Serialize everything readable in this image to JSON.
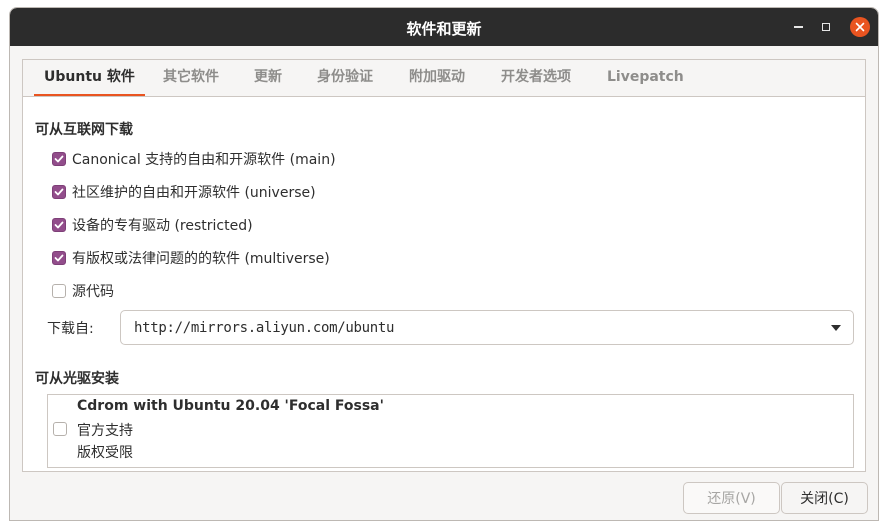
{
  "window": {
    "title": "软件和更新"
  },
  "tabs": [
    {
      "label": "Ubuntu 软件",
      "active": true
    },
    {
      "label": "其它软件"
    },
    {
      "label": "更新"
    },
    {
      "label": "身份验证"
    },
    {
      "label": "附加驱动"
    },
    {
      "label": "开发者选项"
    },
    {
      "label": "Livepatch"
    }
  ],
  "internet": {
    "title": "可从互联网下载",
    "options": [
      {
        "label": "Canonical 支持的自由和开源软件 (main)",
        "checked": true
      },
      {
        "label": "社区维护的自由和开源软件 (universe)",
        "checked": true
      },
      {
        "label": "设备的专有驱动 (restricted)",
        "checked": true
      },
      {
        "label": "有版权或法律问题的的软件 (multiverse)",
        "checked": true
      },
      {
        "label": "源代码",
        "checked": false
      }
    ],
    "download_from_label": "下载自:",
    "download_from_value": "http://mirrors.aliyun.com/ubuntu"
  },
  "cdrom": {
    "title": "可从光驱安装",
    "name": "Cdrom with Ubuntu 20.04 'Focal Fossa'",
    "line1": "官方支持",
    "line2": "版权受限",
    "checked": false
  },
  "buttons": {
    "revert": "还原(V)",
    "close": "关闭(C)"
  },
  "colors": {
    "accent": "#e95420",
    "checkbox": "#924d8b",
    "titlebar": "#2c2c2c"
  }
}
